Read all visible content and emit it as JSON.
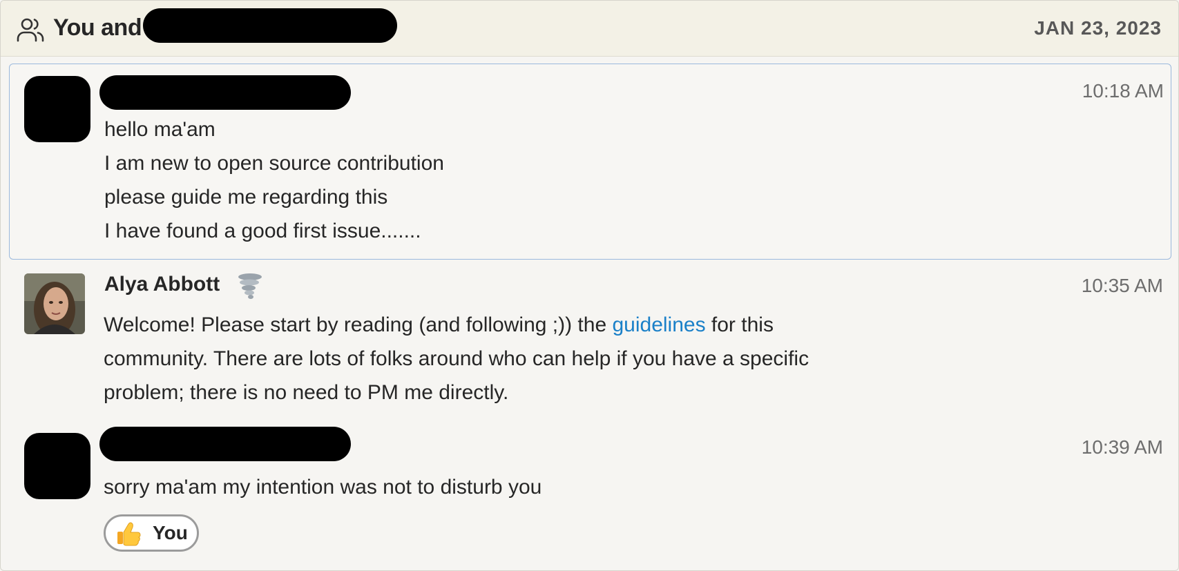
{
  "header": {
    "title": "You and",
    "date": "JAN 23, 2023"
  },
  "messages": [
    {
      "time": "10:18 AM",
      "lines": [
        "hello ma'am",
        "I am new to open source contribution",
        "please guide me regarding this",
        "I have found a good first issue......."
      ]
    },
    {
      "sender": "Alya Abbott",
      "time": "10:35 AM",
      "text_before_link": "Welcome! Please start by reading (and following ;)) the ",
      "link_text": "guidelines",
      "text_after_link": " for this",
      "line2": "community. There are lots of folks around who can help if you have a specific",
      "line3": "problem; there is no need to PM me directly.",
      "status_emoji": "tornado-icon"
    },
    {
      "time": "10:39 AM",
      "lines": [
        "sorry ma'am my intention was not to disturb you"
      ],
      "reaction": {
        "emoji": "thumbs-up-icon",
        "label": "You"
      }
    }
  ],
  "colors": {
    "header_bg": "#f3f1e6",
    "page_bg": "#f6f5f2",
    "link": "#1a80c8",
    "selected_border": "#9ab8dc",
    "time_text": "#6d6d6d"
  }
}
